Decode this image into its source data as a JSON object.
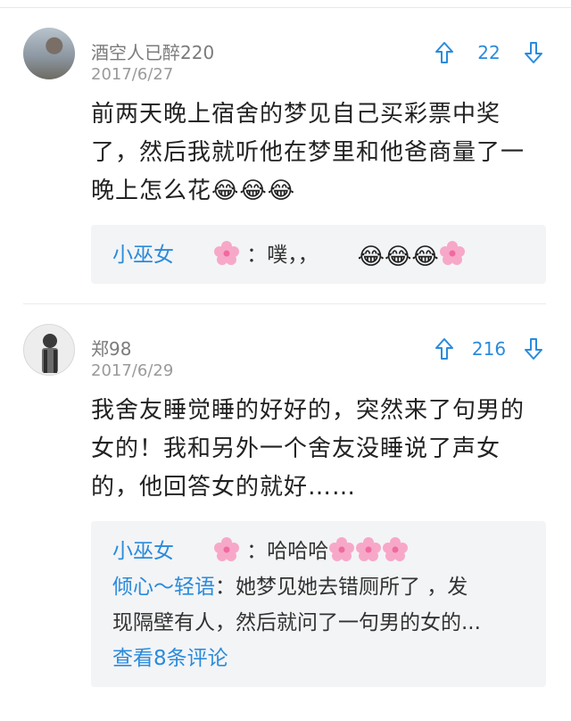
{
  "comments": [
    {
      "username": "酒空人已醉220",
      "date": "2017/6/27",
      "votes": "22",
      "text_lines": [
        "前两天晚上宿舍的梦见自己买彩票中奖",
        "了，然后我就听他在梦里和他爸商量了一",
        "晚上怎么花😂😂😂"
      ],
      "replies": [
        {
          "user": "小巫女",
          "text": "：噗，，"
        }
      ]
    },
    {
      "username": "郑98",
      "date": "2017/6/29",
      "votes": "216",
      "text_lines": [
        "我舍友睡觉睡的好好的，突然来了句男的",
        "女的！我和另外一个舍友没睡说了声女",
        "的，他回答女的就好……"
      ],
      "replies": [
        {
          "user": "小巫女",
          "text": "：哈哈哈"
        },
        {
          "user": "倾心～轻语",
          "text": "：她梦见她去错厕所了 ，发"
        },
        {
          "user": "",
          "text": "现隔壁有人，然后就问了一句男的女的..."
        }
      ],
      "more_label": "查看8条评论"
    }
  ],
  "colors": {
    "accent": "#2a8bdc",
    "reply_bg": "#f3f4f6"
  },
  "icons": [
    "thumb-up-arrow-icon",
    "thumb-down-arrow-icon",
    "cherry-blossom-icon",
    "laughing-tears-emoji"
  ]
}
